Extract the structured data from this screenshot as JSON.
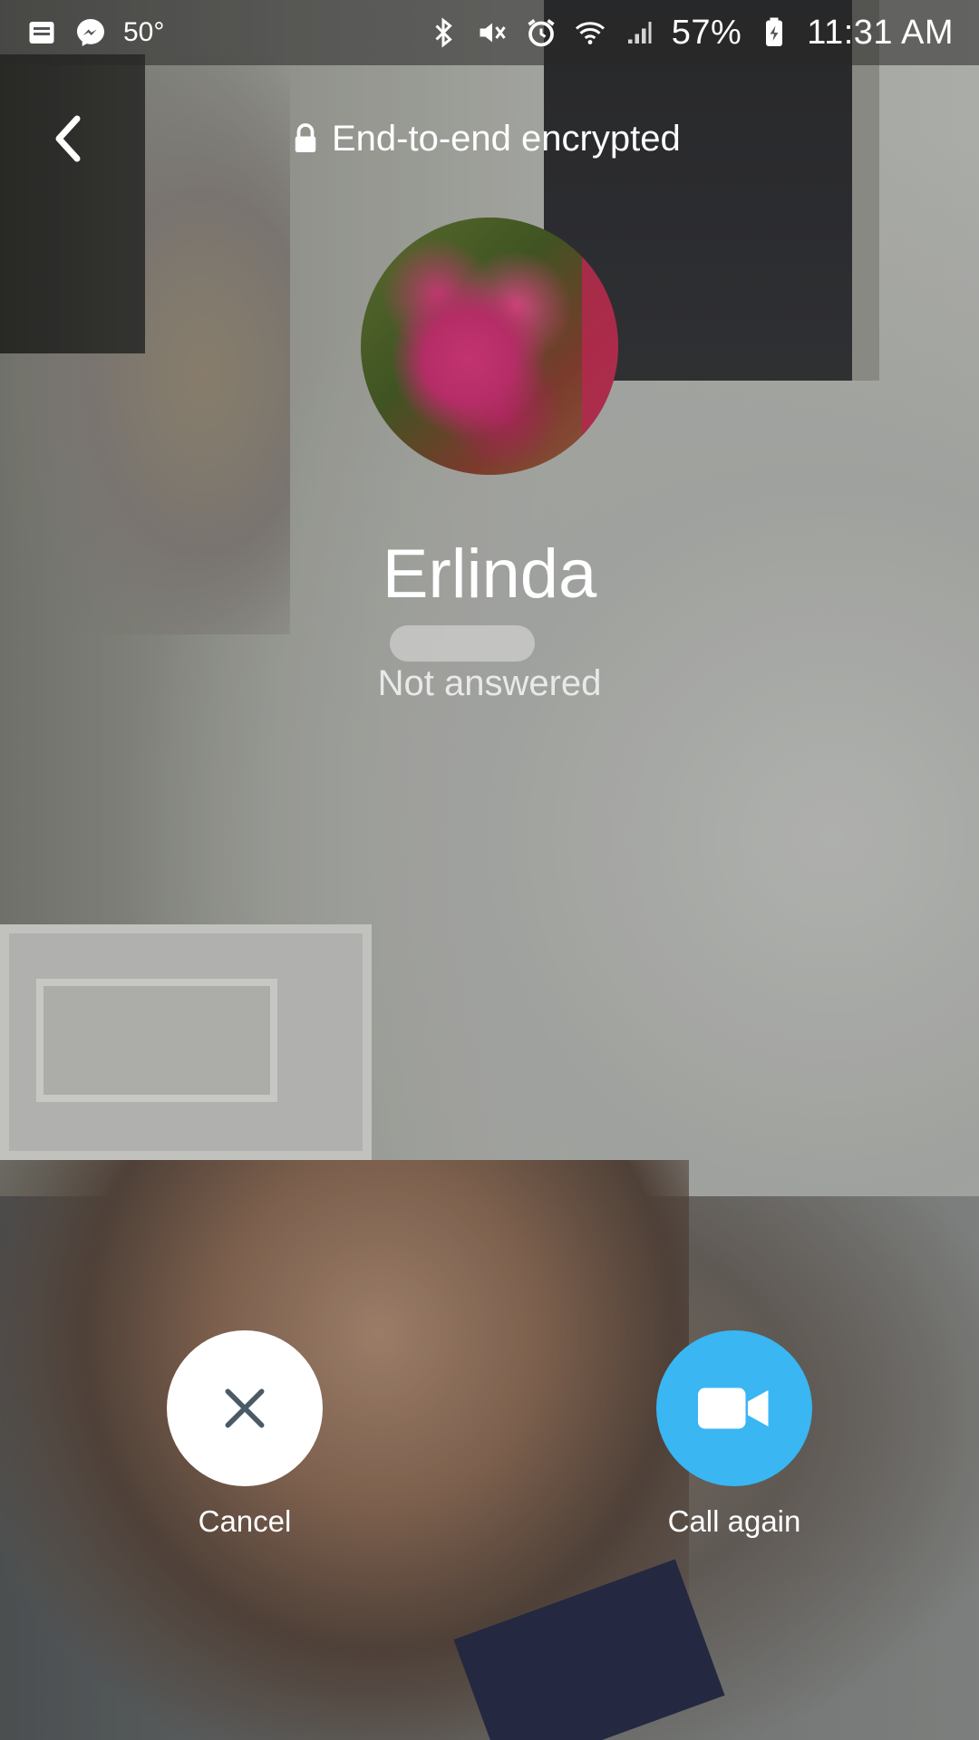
{
  "status_bar": {
    "temperature": "50°",
    "battery_percent": "57%",
    "time": "11:31 AM",
    "icons": [
      "notification-icon",
      "messenger-icon",
      "bluetooth-icon",
      "mute-icon",
      "alarm-icon",
      "wifi-icon",
      "signal-icon",
      "battery-charging-icon"
    ]
  },
  "header": {
    "back_icon": "chevron-left-icon",
    "lock_icon": "lock-icon",
    "encryption_label": "End-to-end encrypted"
  },
  "contact": {
    "name": "Erlinda",
    "call_status": "Not answered"
  },
  "actions": {
    "cancel_label": "Cancel",
    "call_again_label": "Call again"
  },
  "colors": {
    "call_again": "#3ab6f2",
    "cancel": "#ffffff",
    "cancel_icon": "#4a5a66"
  }
}
